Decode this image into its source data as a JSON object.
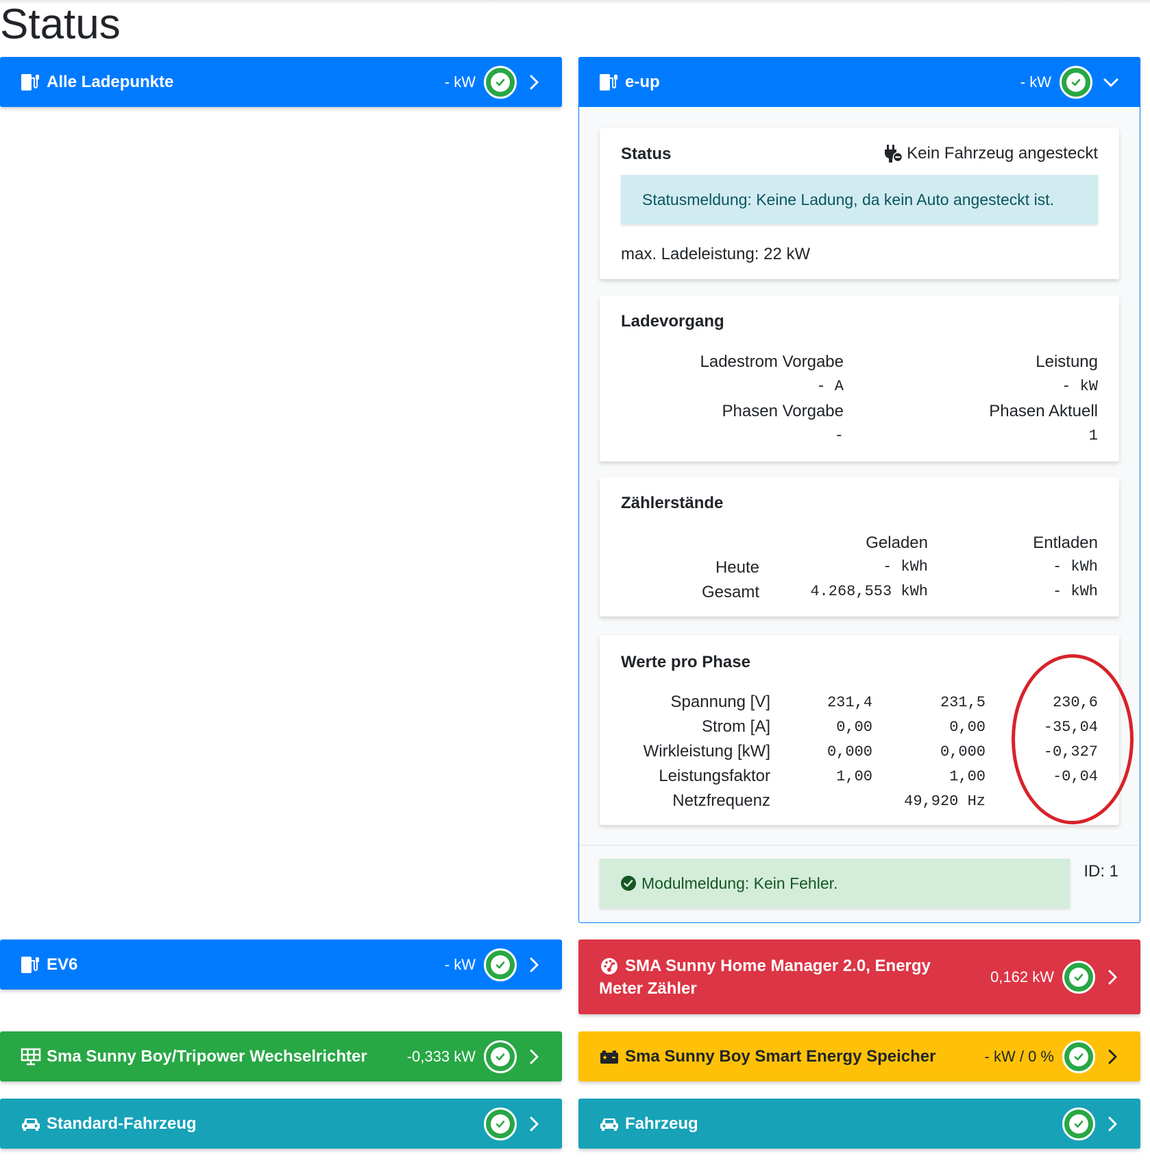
{
  "page": {
    "title": "Status"
  },
  "icons": {
    "chargepoint": "charging-station-icon",
    "ok": "check-circle-icon",
    "chevron_right": "chevron-right-icon",
    "chevron_down": "chevron-down-icon",
    "plug": "plug-off-icon",
    "counter": "tachometer-icon",
    "solar": "solar-panel-icon",
    "battery": "car-battery-icon",
    "vehicle": "car-icon"
  },
  "colors": {
    "primary": "#007bff",
    "danger": "#dc3545",
    "success": "#28a745",
    "warning": "#ffc107",
    "info": "#17a2b8",
    "annotation": "#d8222a"
  },
  "cards": {
    "all_chargepoints": {
      "title": "Alle Ladepunkte",
      "power": "- kW"
    },
    "eup": {
      "title": "e-up",
      "power": "- kW"
    },
    "ev6": {
      "title": "EV6",
      "power": "- kW"
    },
    "counter": {
      "title_line1": "SMA Sunny Home Manager 2.0, Energy",
      "title_line2": "Meter Zähler",
      "power": "0,162 kW"
    },
    "inverter": {
      "title": "Sma Sunny Boy/Tripower Wechselrichter",
      "power": "-0,333 kW"
    },
    "battery": {
      "title": "Sma Sunny Boy Smart Energy Speicher",
      "power": "- kW / 0 %"
    },
    "std_vehicle": {
      "title": "Standard-Fahrzeug"
    },
    "vehicle": {
      "title": "Fahrzeug"
    }
  },
  "eup_detail": {
    "status": {
      "title": "Status",
      "plug_state": "Kein Fahrzeug angesteckt",
      "message": "Statusmeldung: Keine Ladung, da kein Auto angesteckt ist.",
      "max_power": "max. Ladeleistung: 22 kW"
    },
    "charging": {
      "title": "Ladevorgang",
      "current_label": "Ladestrom Vorgabe",
      "current_value": "- A",
      "power_label": "Leistung",
      "power_value": "- kW",
      "phases_set_label": "Phasen Vorgabe",
      "phases_set_value": "-",
      "phases_actual_label": "Phasen Aktuell",
      "phases_actual_value": "1"
    },
    "meters": {
      "title": "Zählerstände",
      "col_charged": "Geladen",
      "col_discharged": "Entladen",
      "rows": [
        {
          "label": "Heute",
          "charged": "- kWh",
          "discharged": "- kWh"
        },
        {
          "label": "Gesamt",
          "charged": "4.268,553 kWh",
          "discharged": "- kWh"
        }
      ]
    },
    "phases": {
      "title": "Werte pro Phase",
      "rows": [
        {
          "label": "Spannung [V]",
          "p1": "231,4",
          "p2": "231,5",
          "p3": "230,6"
        },
        {
          "label": "Strom [A]",
          "p1": "0,00",
          "p2": "0,00",
          "p3": "-35,04"
        },
        {
          "label": "Wirkleistung [kW]",
          "p1": "0,000",
          "p2": "0,000",
          "p3": "-0,327"
        },
        {
          "label": "Leistungsfaktor",
          "p1": "1,00",
          "p2": "1,00",
          "p3": "-0,04"
        }
      ],
      "frequency_label": "Netzfrequenz",
      "frequency_value": "49,920 Hz"
    },
    "module_message": "Modulmeldung: Kein Fehler.",
    "id": "ID: 1"
  }
}
